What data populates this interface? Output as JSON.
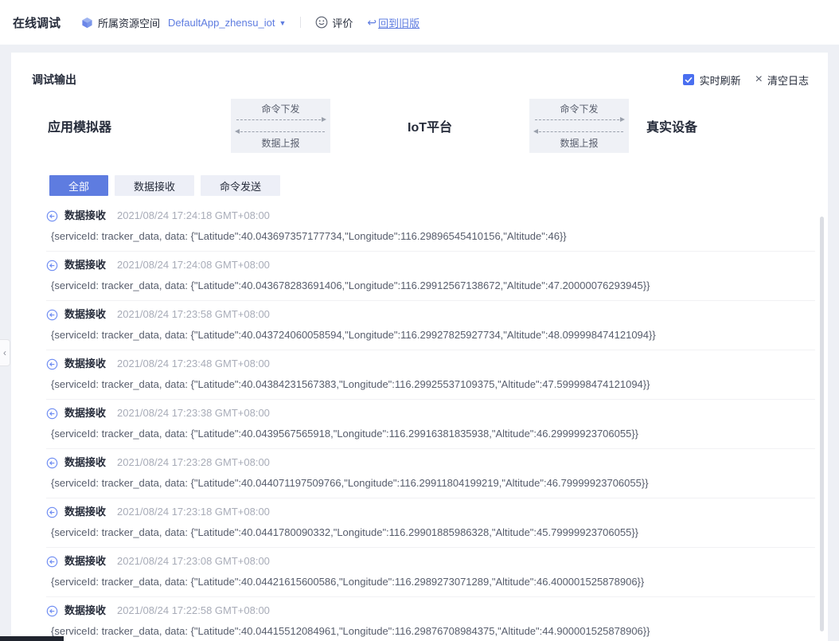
{
  "header": {
    "title": "在线调试",
    "resource_space": {
      "label": "所属资源空间",
      "value": "DefaultApp_zhensu_iot"
    },
    "feedback_label": "评价",
    "back_link_label": "回到旧版"
  },
  "panel": {
    "title": "调试输出",
    "realtime_refresh_label": "实时刷新",
    "clear_log_label": "清空日志"
  },
  "diagram": {
    "nodes": [
      {
        "label": "应用模拟器"
      },
      {
        "label": "IoT平台"
      },
      {
        "label": "真实设备"
      }
    ],
    "command_down_label": "命令下发",
    "data_report_label": "数据上报"
  },
  "tabs": [
    {
      "label": "全部",
      "active": true
    },
    {
      "label": "数据接收",
      "active": false
    },
    {
      "label": "命令发送",
      "active": false
    }
  ],
  "icons": {
    "dropdown": "▼",
    "clear": "×",
    "back": "↩",
    "collapse": "‹"
  },
  "colors": {
    "accent_blue": "#5e7ce0",
    "active_tab_bg": "#5e7ce0",
    "checkbox_blue": "#4a6ff0"
  },
  "logs": [
    {
      "type": "数据接收",
      "time": "2021/08/24 17:24:18 GMT+08:00",
      "message": "{serviceId: tracker_data, data: {\"Latitude\":40.043697357177734,\"Longitude\":116.29896545410156,\"Altitude\":46}}"
    },
    {
      "type": "数据接收",
      "time": "2021/08/24 17:24:08 GMT+08:00",
      "message": "{serviceId: tracker_data, data: {\"Latitude\":40.043678283691406,\"Longitude\":116.29912567138672,\"Altitude\":47.20000076293945}}"
    },
    {
      "type": "数据接收",
      "time": "2021/08/24 17:23:58 GMT+08:00",
      "message": "{serviceId: tracker_data, data: {\"Latitude\":40.043724060058594,\"Longitude\":116.29927825927734,\"Altitude\":48.099998474121094}}"
    },
    {
      "type": "数据接收",
      "time": "2021/08/24 17:23:48 GMT+08:00",
      "message": "{serviceId: tracker_data, data: {\"Latitude\":40.04384231567383,\"Longitude\":116.29925537109375,\"Altitude\":47.599998474121094}}"
    },
    {
      "type": "数据接收",
      "time": "2021/08/24 17:23:38 GMT+08:00",
      "message": "{serviceId: tracker_data, data: {\"Latitude\":40.0439567565918,\"Longitude\":116.29916381835938,\"Altitude\":46.29999923706055}}"
    },
    {
      "type": "数据接收",
      "time": "2021/08/24 17:23:28 GMT+08:00",
      "message": "{serviceId: tracker_data, data: {\"Latitude\":40.044071197509766,\"Longitude\":116.29911804199219,\"Altitude\":46.79999923706055}}"
    },
    {
      "type": "数据接收",
      "time": "2021/08/24 17:23:18 GMT+08:00",
      "message": "{serviceId: tracker_data, data: {\"Latitude\":40.0441780090332,\"Longitude\":116.29901885986328,\"Altitude\":45.79999923706055}}"
    },
    {
      "type": "数据接收",
      "time": "2021/08/24 17:23:08 GMT+08:00",
      "message": "{serviceId: tracker_data, data: {\"Latitude\":40.04421615600586,\"Longitude\":116.2989273071289,\"Altitude\":46.400001525878906}}"
    },
    {
      "type": "数据接收",
      "time": "2021/08/24 17:22:58 GMT+08:00",
      "message": "{serviceId: tracker_data, data: {\"Latitude\":40.04415512084961,\"Longitude\":116.29876708984375,\"Altitude\":44.900001525878906}}"
    }
  ]
}
